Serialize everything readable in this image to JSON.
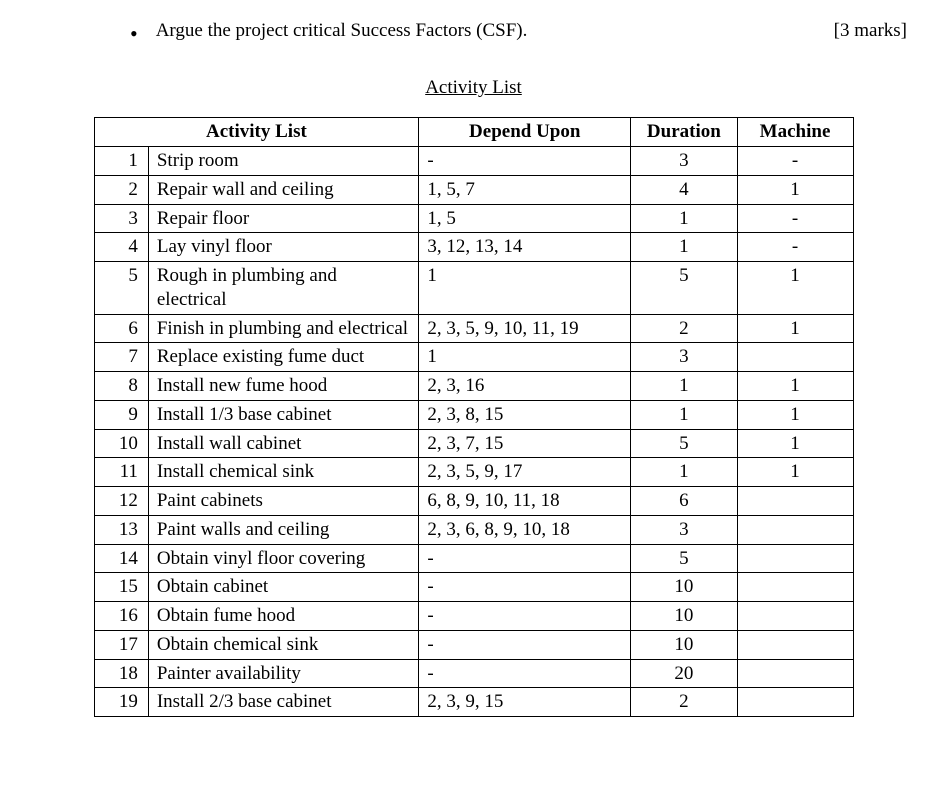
{
  "top": {
    "bullet_text": "Argue the project critical Success Factors (CSF).",
    "marks": "[3 marks]"
  },
  "title": "Activity List",
  "chart_data": {
    "type": "table",
    "headers": {
      "activity": "Activity List",
      "depend": "Depend Upon",
      "duration": "Duration",
      "machine": "Machine"
    },
    "rows": [
      {
        "num": "1",
        "activity": "Strip room",
        "depend": "-",
        "duration": "3",
        "machine": "-"
      },
      {
        "num": "2",
        "activity": "Repair wall and ceiling",
        "depend": "1, 5, 7",
        "duration": "4",
        "machine": "1"
      },
      {
        "num": "3",
        "activity": "Repair floor",
        "depend": "1, 5",
        "duration": "1",
        "machine": "-"
      },
      {
        "num": "4",
        "activity": "Lay vinyl floor",
        "depend": "3, 12, 13, 14",
        "duration": "1",
        "machine": "-"
      },
      {
        "num": "5",
        "activity": "Rough in plumbing and electrical",
        "depend": "1",
        "duration": "5",
        "machine": "1"
      },
      {
        "num": "6",
        "activity": "Finish in plumbing and electrical",
        "depend": "2, 3, 5, 9, 10, 11, 19",
        "duration": "2",
        "machine": "1"
      },
      {
        "num": "7",
        "activity": "Replace existing fume duct",
        "depend": "1",
        "duration": "3",
        "machine": ""
      },
      {
        "num": "8",
        "activity": "Install new fume hood",
        "depend": "2, 3, 16",
        "duration": "1",
        "machine": "1"
      },
      {
        "num": "9",
        "activity": "Install 1/3 base cabinet",
        "depend": "2, 3, 8, 15",
        "duration": "1",
        "machine": "1"
      },
      {
        "num": "10",
        "activity": "Install wall cabinet",
        "depend": "2, 3, 7, 15",
        "duration": "5",
        "machine": "1"
      },
      {
        "num": "11",
        "activity": "Install chemical sink",
        "depend": "2, 3, 5, 9, 17",
        "duration": "1",
        "machine": "1"
      },
      {
        "num": "12",
        "activity": "Paint cabinets",
        "depend": "6, 8, 9, 10, 11, 18",
        "duration": "6",
        "machine": ""
      },
      {
        "num": "13",
        "activity": "Paint walls and ceiling",
        "depend": "2, 3, 6, 8, 9, 10, 18",
        "duration": "3",
        "machine": ""
      },
      {
        "num": "14",
        "activity": "Obtain vinyl floor covering",
        "depend": "-",
        "duration": "5",
        "machine": ""
      },
      {
        "num": "15",
        "activity": "Obtain cabinet",
        "depend": "-",
        "duration": "10",
        "machine": ""
      },
      {
        "num": "16",
        "activity": "Obtain fume hood",
        "depend": "-",
        "duration": "10",
        "machine": ""
      },
      {
        "num": "17",
        "activity": "Obtain chemical sink",
        "depend": "-",
        "duration": "10",
        "machine": ""
      },
      {
        "num": "18",
        "activity": "Painter availability",
        "depend": "-",
        "duration": "20",
        "machine": ""
      },
      {
        "num": "19",
        "activity": "Install 2/3 base cabinet",
        "depend": "2, 3, 9, 15",
        "duration": "2",
        "machine": ""
      }
    ]
  }
}
